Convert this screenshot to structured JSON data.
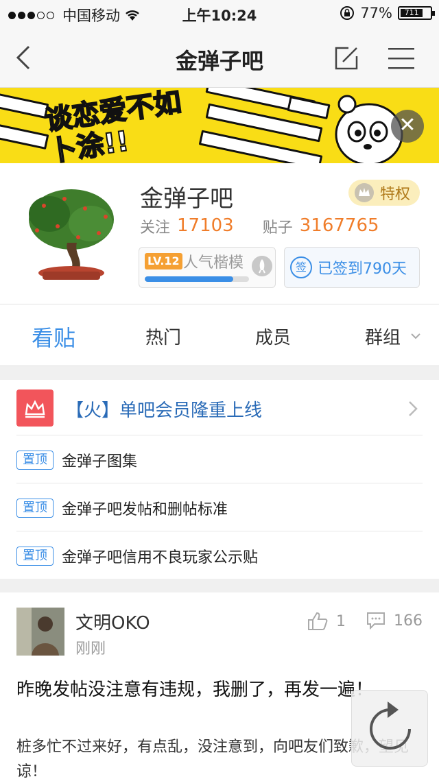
{
  "status": {
    "carrier": "中国移动",
    "time": "上午10:24",
    "battery": "77%",
    "battery_label": "711",
    "signal_full": 3,
    "signal_total": 5
  },
  "nav": {
    "title": "金弹子吧"
  },
  "banner": {
    "slogan": "谈恋爱不如卜涂!!"
  },
  "forum": {
    "name": "金弹子吧",
    "privilege_label": "特权",
    "follow_label": "关注",
    "follow_count": "17103",
    "posts_label": "贴子",
    "posts_count": "3167765",
    "level_badge": "LV.12",
    "level_name": "人气楷模",
    "level_progress": 0.85,
    "sign_icon": "签",
    "sign_text": "已签到790天"
  },
  "tabs": [
    {
      "label": "看贴"
    },
    {
      "label": "热门"
    },
    {
      "label": "成员"
    },
    {
      "label": "群组"
    }
  ],
  "promo": {
    "text": "【火】单吧会员隆重上线"
  },
  "pinned": [
    {
      "tag": "置顶",
      "title": "金弹子图集"
    },
    {
      "tag": "置顶",
      "title": "金弹子吧发帖和删帖标准"
    },
    {
      "tag": "置顶",
      "title": "金弹子吧信用不良玩家公示贴"
    }
  ],
  "post": {
    "author": "文明OKO",
    "time": "刚刚",
    "likes": "1",
    "replies": "166",
    "title": "昨晚发帖没注意有违规，我删了，再发一遍！",
    "body": "桩多忙不过来好，有点乱，没注意到，向吧友们致歉，望见谅！"
  },
  "colors": {
    "accent": "#3a8ee6",
    "orange": "#f07d2a",
    "banner_yellow": "#f9dd16",
    "promo_red": "#f2555b"
  }
}
